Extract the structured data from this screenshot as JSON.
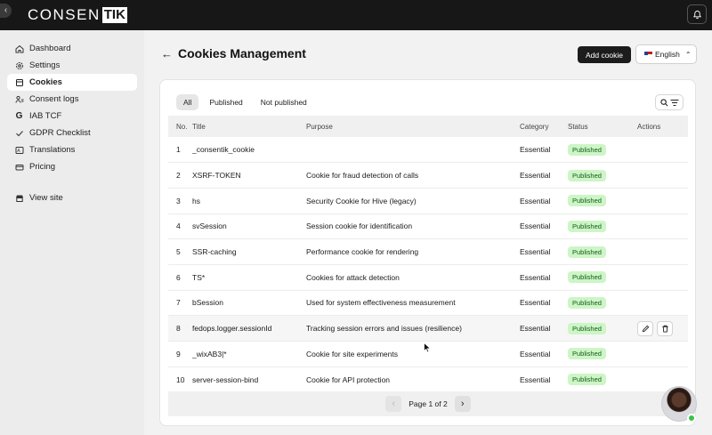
{
  "topbar": {
    "logo_left": "CONSEN",
    "logo_right": "TIK",
    "collapse_icon": "chevron-left-icon",
    "bell_icon": "bell-icon"
  },
  "sidebar": {
    "items": [
      {
        "label": "Dashboard",
        "icon": "home-icon"
      },
      {
        "label": "Settings",
        "icon": "gear-icon"
      },
      {
        "label": "Cookies",
        "icon": "cookie-icon",
        "active": true
      },
      {
        "label": "Consent logs",
        "icon": "user-list-icon"
      },
      {
        "label": "IAB TCF",
        "icon": "google-icon"
      },
      {
        "label": "GDPR Checklist",
        "icon": "check-icon"
      },
      {
        "label": "Translations",
        "icon": "translate-icon"
      },
      {
        "label": "Pricing",
        "icon": "card-icon"
      }
    ],
    "view_site": {
      "label": "View site",
      "icon": "store-icon"
    }
  },
  "header": {
    "back_icon": "arrow-left-icon",
    "title": "Cookies Management",
    "add_button": "Add cookie",
    "language": "English"
  },
  "filters": {
    "tabs": [
      "All",
      "Published",
      "Not published"
    ],
    "active_tab": "All"
  },
  "table": {
    "columns": [
      "No.",
      "Title",
      "Purpose",
      "Category",
      "Status",
      "Actions"
    ],
    "rows": [
      {
        "no": "1",
        "title": "_consentik_cookie",
        "purpose": "",
        "category": "Essential",
        "status": "Published"
      },
      {
        "no": "2",
        "title": "XSRF-TOKEN",
        "purpose": "Cookie for fraud detection of calls",
        "category": "Essential",
        "status": "Published"
      },
      {
        "no": "3",
        "title": "hs",
        "purpose": "Security Cookie for Hive (legacy)",
        "category": "Essential",
        "status": "Published"
      },
      {
        "no": "4",
        "title": "svSession",
        "purpose": "Session cookie for identification",
        "category": "Essential",
        "status": "Published"
      },
      {
        "no": "5",
        "title": "SSR-caching",
        "purpose": "Performance cookie for rendering",
        "category": "Essential",
        "status": "Published"
      },
      {
        "no": "6",
        "title": "TS*",
        "purpose": "Cookies for attack detection",
        "category": "Essential",
        "status": "Published"
      },
      {
        "no": "7",
        "title": "bSession",
        "purpose": "Used for system effectiveness measurement",
        "category": "Essential",
        "status": "Published"
      },
      {
        "no": "8",
        "title": "fedops.logger.sessionId",
        "purpose": "Tracking session errors and issues (resilience)",
        "category": "Essential",
        "status": "Published"
      },
      {
        "no": "9",
        "title": "_wixAB3|*",
        "purpose": "Cookie for site experiments",
        "category": "Essential",
        "status": "Published"
      },
      {
        "no": "10",
        "title": "server-session-bind",
        "purpose": "Cookie for API protection",
        "category": "Essential",
        "status": "Published"
      }
    ]
  },
  "pagination": {
    "label": "Page 1 of 2"
  },
  "colors": {
    "accent_dark": "#1c1c1c",
    "badge_bg": "#cdf5c6",
    "badge_text": "#145c1a",
    "online": "#3bc14a"
  }
}
